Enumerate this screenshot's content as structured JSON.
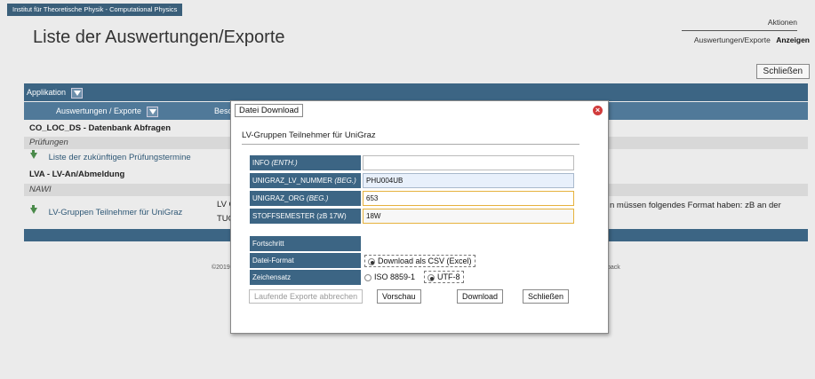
{
  "header": {
    "institute": "Institut für Theoretische Physik - Computational Physics",
    "title": "Liste der Auswertungen/Exporte",
    "aktionen_label": "Aktionen",
    "link_exports": "Auswertungen/Exporte",
    "link_show": "Anzeigen",
    "close_button": "Schließen"
  },
  "table": {
    "application_header": "Applikation",
    "col_exports": "Auswertungen / Exporte",
    "col_description": "Besc",
    "rows": [
      {
        "text": "CO_LOC_DS - Datenbank Abfragen",
        "kind": "group"
      },
      {
        "text": "Prüfungen",
        "kind": "category"
      },
      {
        "text": "Liste der zukünftigen Prüfungstermine",
        "kind": "link"
      },
      {
        "text": "LVA - LV-An/Abmeldung",
        "kind": "group"
      },
      {
        "text": "NAWI",
        "kind": "category"
      },
      {
        "text": "LV-Gruppen Teilnehmer für UniGraz",
        "kind": "link"
      }
    ],
    "desc_line1": "LV G",
    "desc_line2": "TUG",
    "desc_right": "n müssen folgendes Format haben: zB an der"
  },
  "footer": {
    "left": "©2019",
    "right": "back"
  },
  "dialog": {
    "title": "Datei Download",
    "close_icon": "close-icon",
    "subtitle": "LV-Gruppen Teilnehmer für UniGraz",
    "fields": [
      {
        "label": "INFO",
        "hint": "(ENTH.)",
        "value": ""
      },
      {
        "label": "UNIGRAZ_LV_NUMMER",
        "hint": "(BEG.)",
        "value": "PHU004UB"
      },
      {
        "label": "UNIGRAZ_ORG",
        "hint": "(BEG.)",
        "value": "653"
      },
      {
        "label": "STOFFSEMESTER (zB 17W)",
        "hint": "",
        "value": "18W"
      }
    ],
    "progress_label": "Fortschritt",
    "format_label": "Datei-Format",
    "format_option": "Download als CSV (Excel)",
    "charset_label": "Zeichensatz",
    "charset_options": [
      "ISO 8859-1",
      "UTF-8"
    ],
    "charset_selected": "UTF-8",
    "buttons": {
      "cancel_exports": "Laufende Exporte abbrechen",
      "preview": "Vorschau",
      "download": "Download",
      "close": "Schließen"
    }
  }
}
